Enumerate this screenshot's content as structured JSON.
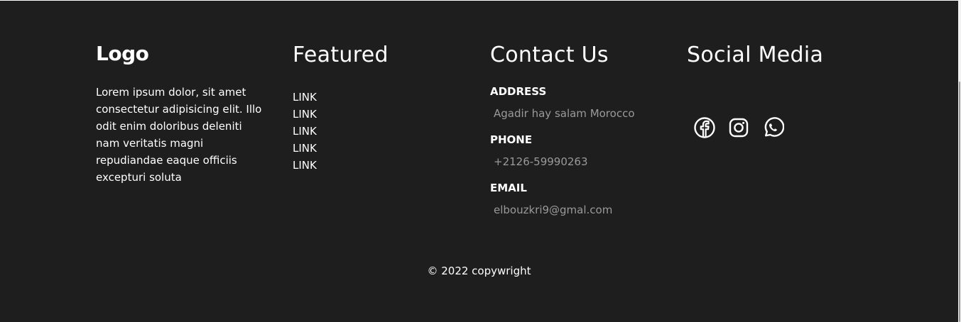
{
  "brand": {
    "logo_text": "Logo",
    "about": "Lorem ipsum dolor, sit amet consectetur adipisicing elit. Illo odit enim doloribus deleniti nam veritatis magni repudiandae eaque officiis excepturi soluta"
  },
  "featured": {
    "title": "Featured",
    "links": [
      "LINK",
      "LINK",
      "LINK",
      "LINK",
      "LINK"
    ]
  },
  "contact": {
    "title": "Contact Us",
    "address_label": "ADDRESS",
    "address_value": "Agadir hay salam Morocco",
    "phone_label": "PHONE",
    "phone_value": "+2126-59990263",
    "email_label": "EMAIL",
    "email_value": "elbouzkri9@gmal.com"
  },
  "social": {
    "title": "Social Media",
    "icons": [
      "facebook-icon",
      "instagram-icon",
      "whatsapp-icon"
    ]
  },
  "footer": {
    "copyright": "© 2022 copywright"
  },
  "colors": {
    "background": "#1e1e1e",
    "text": "#ffffff",
    "muted": "#9a9a9a"
  }
}
